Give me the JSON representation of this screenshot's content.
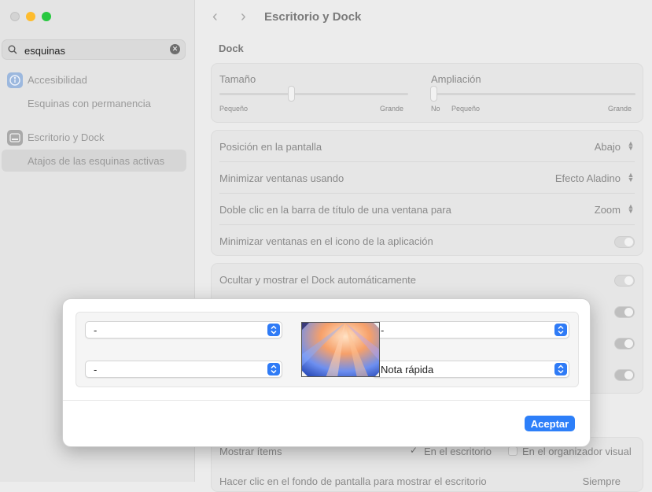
{
  "sidebar": {
    "search": {
      "value": "esquinas"
    },
    "items": [
      {
        "label": "Accesibilidad"
      },
      {
        "label": "Esquinas con permanencia"
      },
      {
        "label": "Escritorio y Dock"
      },
      {
        "label": "Atajos de las esquinas activas"
      }
    ]
  },
  "header": {
    "title": "Escritorio y Dock"
  },
  "dock": {
    "heading": "Dock",
    "size": {
      "label": "Tamaño",
      "min": "Pequeño",
      "max": "Grande",
      "level": 0.38
    },
    "magnification": {
      "label": "Ampliación",
      "off": "No",
      "min": "Pequeño",
      "max": "Grande",
      "level": 0.0
    },
    "rows": [
      {
        "label": "Posición en la pantalla",
        "value": "Abajo"
      },
      {
        "label": "Minimizar ventanas usando",
        "value": "Efecto Aladino"
      },
      {
        "label": "Doble clic en la barra de título de una ventana para",
        "value": "Zoom"
      },
      {
        "label": "Minimizar ventanas en el icono de la aplicación"
      }
    ],
    "autohide": {
      "label": "Ocultar y mostrar el Dock automáticamente"
    }
  },
  "bottom": {
    "show_items_label": "Mostrar ítems",
    "opt_desktop": "En el escritorio",
    "opt_stage": "En el organizador visual",
    "click_wallpaper_label": "Hacer clic en el fondo de pantalla para mostrar el escritorio",
    "click_wallpaper_value": "Siempre"
  },
  "modal": {
    "top_left": "-",
    "top_right": "-",
    "bottom_left": "-",
    "bottom_right": "Nota rápida",
    "ok_label": "Aceptar"
  },
  "colors": {
    "accent": "#2d7ff9",
    "close": "#d3d3d3",
    "minimize": "#febc2e",
    "maximize": "#28c840"
  }
}
